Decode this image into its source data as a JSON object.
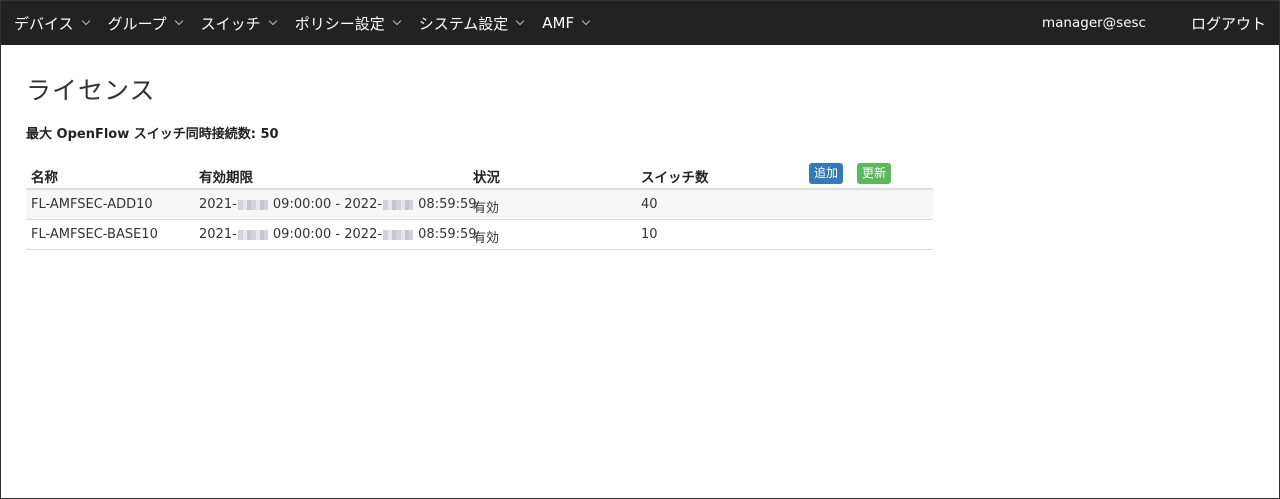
{
  "navbar": {
    "items": [
      {
        "label": "デバイス"
      },
      {
        "label": "グループ"
      },
      {
        "label": "スイッチ"
      },
      {
        "label": "ポリシー設定"
      },
      {
        "label": "システム設定"
      },
      {
        "label": "AMF"
      }
    ],
    "user": "manager@sesc",
    "logout": "ログアウト"
  },
  "page": {
    "title": "ライセンス",
    "max_connections": "最大 OpenFlow スイッチ同時接続数: 50"
  },
  "table": {
    "headers": {
      "name": "名称",
      "period": "有効期限",
      "status": "状況",
      "switch_count": "スイッチ数"
    },
    "add_label": "追加",
    "update_label": "更新",
    "rows": [
      {
        "name": "FL-AMFSEC-ADD10",
        "start_prefix": "2021-",
        "start_time": " 09:00:00 - 2022-",
        "end_time": " 08:59:59",
        "status": "有効",
        "switch_count": "40"
      },
      {
        "name": "FL-AMFSEC-BASE10",
        "start_prefix": "2021-",
        "start_time": " 09:00:00 - 2022-",
        "end_time": " 08:59:59",
        "status": "有効",
        "switch_count": "10"
      }
    ]
  }
}
